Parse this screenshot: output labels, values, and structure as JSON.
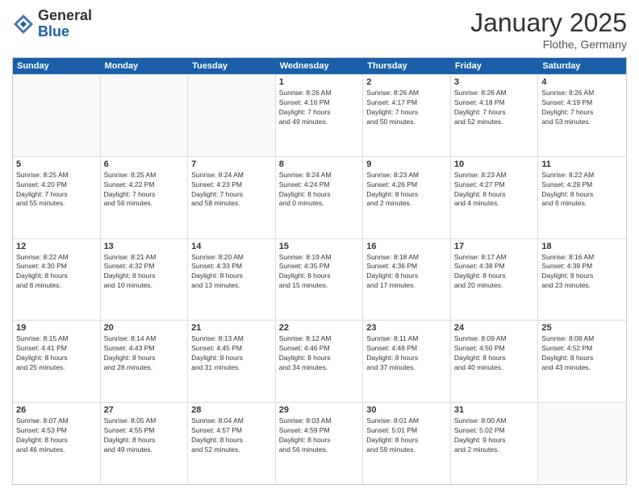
{
  "header": {
    "logo_general": "General",
    "logo_blue": "Blue",
    "month_year": "January 2025",
    "location": "Flothe, Germany"
  },
  "weekdays": [
    "Sunday",
    "Monday",
    "Tuesday",
    "Wednesday",
    "Thursday",
    "Friday",
    "Saturday"
  ],
  "rows": [
    [
      {
        "day": "",
        "info": "",
        "empty": true
      },
      {
        "day": "",
        "info": "",
        "empty": true
      },
      {
        "day": "",
        "info": "",
        "empty": true
      },
      {
        "day": "1",
        "info": "Sunrise: 8:26 AM\nSunset: 4:16 PM\nDaylight: 7 hours\nand 49 minutes."
      },
      {
        "day": "2",
        "info": "Sunrise: 8:26 AM\nSunset: 4:17 PM\nDaylight: 7 hours\nand 50 minutes."
      },
      {
        "day": "3",
        "info": "Sunrise: 8:26 AM\nSunset: 4:18 PM\nDaylight: 7 hours\nand 52 minutes."
      },
      {
        "day": "4",
        "info": "Sunrise: 8:26 AM\nSunset: 4:19 PM\nDaylight: 7 hours\nand 53 minutes."
      }
    ],
    [
      {
        "day": "5",
        "info": "Sunrise: 8:25 AM\nSunset: 4:20 PM\nDaylight: 7 hours\nand 55 minutes."
      },
      {
        "day": "6",
        "info": "Sunrise: 8:25 AM\nSunset: 4:22 PM\nDaylight: 7 hours\nand 56 minutes."
      },
      {
        "day": "7",
        "info": "Sunrise: 8:24 AM\nSunset: 4:23 PM\nDaylight: 7 hours\nand 58 minutes."
      },
      {
        "day": "8",
        "info": "Sunrise: 8:24 AM\nSunset: 4:24 PM\nDaylight: 8 hours\nand 0 minutes."
      },
      {
        "day": "9",
        "info": "Sunrise: 8:23 AM\nSunset: 4:26 PM\nDaylight: 8 hours\nand 2 minutes."
      },
      {
        "day": "10",
        "info": "Sunrise: 8:23 AM\nSunset: 4:27 PM\nDaylight: 8 hours\nand 4 minutes."
      },
      {
        "day": "11",
        "info": "Sunrise: 8:22 AM\nSunset: 4:29 PM\nDaylight: 8 hours\nand 6 minutes."
      }
    ],
    [
      {
        "day": "12",
        "info": "Sunrise: 8:22 AM\nSunset: 4:30 PM\nDaylight: 8 hours\nand 8 minutes."
      },
      {
        "day": "13",
        "info": "Sunrise: 8:21 AM\nSunset: 4:32 PM\nDaylight: 8 hours\nand 10 minutes."
      },
      {
        "day": "14",
        "info": "Sunrise: 8:20 AM\nSunset: 4:33 PM\nDaylight: 8 hours\nand 13 minutes."
      },
      {
        "day": "15",
        "info": "Sunrise: 8:19 AM\nSunset: 4:35 PM\nDaylight: 8 hours\nand 15 minutes."
      },
      {
        "day": "16",
        "info": "Sunrise: 8:18 AM\nSunset: 4:36 PM\nDaylight: 8 hours\nand 17 minutes."
      },
      {
        "day": "17",
        "info": "Sunrise: 8:17 AM\nSunset: 4:38 PM\nDaylight: 8 hours\nand 20 minutes."
      },
      {
        "day": "18",
        "info": "Sunrise: 8:16 AM\nSunset: 4:39 PM\nDaylight: 8 hours\nand 23 minutes."
      }
    ],
    [
      {
        "day": "19",
        "info": "Sunrise: 8:15 AM\nSunset: 4:41 PM\nDaylight: 8 hours\nand 25 minutes."
      },
      {
        "day": "20",
        "info": "Sunrise: 8:14 AM\nSunset: 4:43 PM\nDaylight: 8 hours\nand 28 minutes."
      },
      {
        "day": "21",
        "info": "Sunrise: 8:13 AM\nSunset: 4:45 PM\nDaylight: 8 hours\nand 31 minutes."
      },
      {
        "day": "22",
        "info": "Sunrise: 8:12 AM\nSunset: 4:46 PM\nDaylight: 8 hours\nand 34 minutes."
      },
      {
        "day": "23",
        "info": "Sunrise: 8:11 AM\nSunset: 4:48 PM\nDaylight: 8 hours\nand 37 minutes."
      },
      {
        "day": "24",
        "info": "Sunrise: 8:09 AM\nSunset: 4:50 PM\nDaylight: 8 hours\nand 40 minutes."
      },
      {
        "day": "25",
        "info": "Sunrise: 8:08 AM\nSunset: 4:52 PM\nDaylight: 8 hours\nand 43 minutes."
      }
    ],
    [
      {
        "day": "26",
        "info": "Sunrise: 8:07 AM\nSunset: 4:53 PM\nDaylight: 8 hours\nand 46 minutes."
      },
      {
        "day": "27",
        "info": "Sunrise: 8:05 AM\nSunset: 4:55 PM\nDaylight: 8 hours\nand 49 minutes."
      },
      {
        "day": "28",
        "info": "Sunrise: 8:04 AM\nSunset: 4:57 PM\nDaylight: 8 hours\nand 52 minutes."
      },
      {
        "day": "29",
        "info": "Sunrise: 8:03 AM\nSunset: 4:59 PM\nDaylight: 8 hours\nand 56 minutes."
      },
      {
        "day": "30",
        "info": "Sunrise: 8:01 AM\nSunset: 5:01 PM\nDaylight: 8 hours\nand 59 minutes."
      },
      {
        "day": "31",
        "info": "Sunrise: 8:00 AM\nSunset: 5:02 PM\nDaylight: 9 hours\nand 2 minutes."
      },
      {
        "day": "",
        "info": "",
        "empty": true
      }
    ]
  ]
}
